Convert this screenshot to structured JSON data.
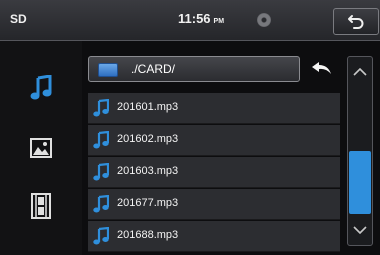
{
  "header": {
    "source": "SD",
    "time": "11:56",
    "ampm": "PM",
    "back_icon": "return-icon",
    "disc_icon": "disc-icon"
  },
  "sidebar": {
    "items": [
      {
        "icon": "music-note-icon",
        "active": true
      },
      {
        "icon": "picture-icon",
        "active": false
      },
      {
        "icon": "film-icon",
        "active": false
      }
    ]
  },
  "path": {
    "folder_icon": "folder-icon",
    "text": "./CARD/",
    "up_icon": "up-folder-arrow-icon"
  },
  "files": [
    {
      "name": "201601.mp3"
    },
    {
      "name": "201602.mp3"
    },
    {
      "name": "201603.mp3"
    },
    {
      "name": "201677.mp3"
    },
    {
      "name": "201688.mp3"
    }
  ],
  "scrollbar": {
    "up_icon": "chevron-up-icon",
    "down_icon": "chevron-down-icon"
  },
  "colors": {
    "accent": "#2f8fdc",
    "background": "#0d0d0f"
  }
}
